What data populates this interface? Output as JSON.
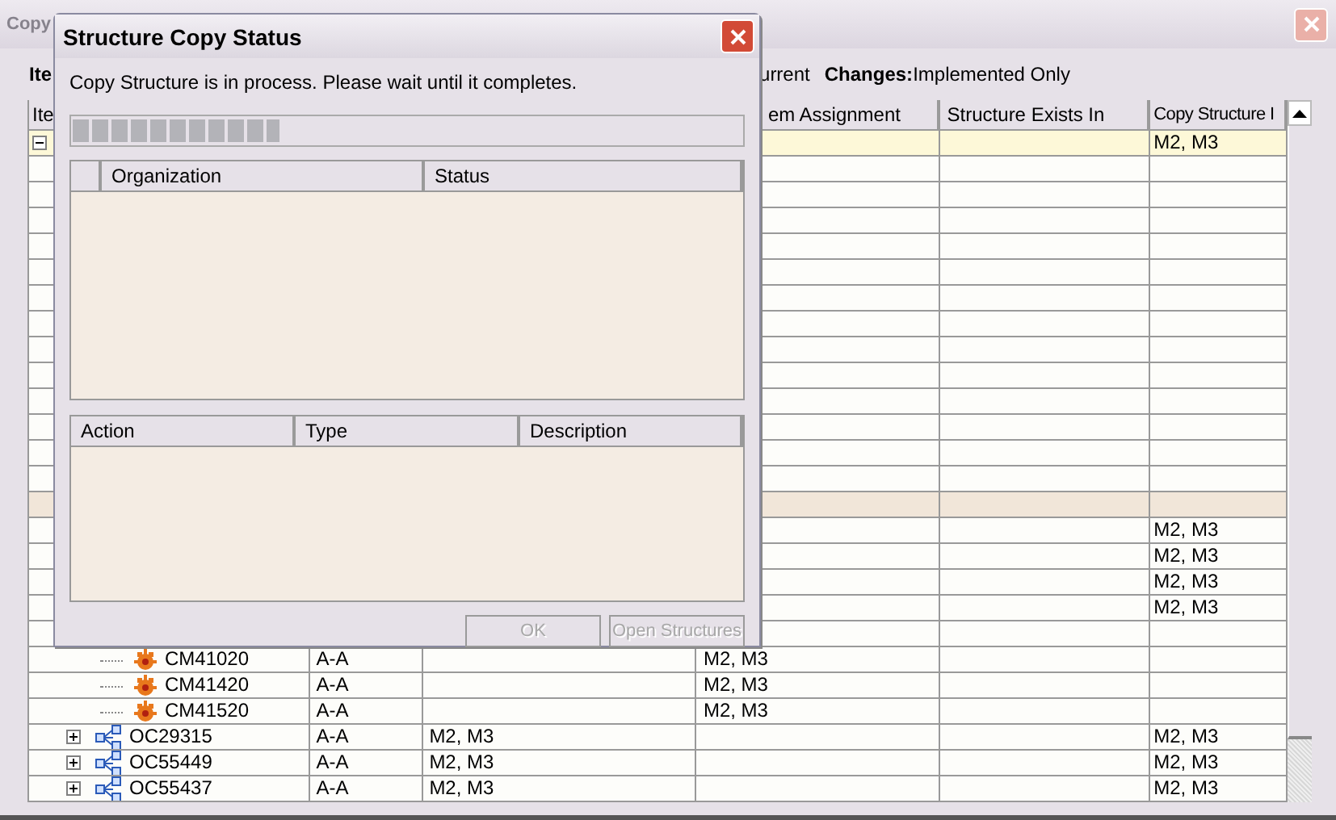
{
  "window": {
    "title": "Copy",
    "close_disabled": true
  },
  "info": {
    "lead": "Ite",
    "filters": [
      "urrent",
      "**Changes:**Implemented Only"
    ]
  },
  "table": {
    "columns": {
      "item": "Ite",
      "assignment": "em Assignment",
      "exists_in": "Structure Exists In",
      "copy_structure": "Copy Structure I"
    },
    "rows": [
      {
        "selected": true,
        "shaded": false,
        "expanded": true,
        "copy_structure": "M2, M3",
        "children": [
          {
            "selected": false,
            "shaded": false
          },
          {
            "selected": false,
            "shaded": false
          },
          {
            "selected": false,
            "shaded": false
          },
          {
            "selected": false,
            "shaded": false
          },
          {
            "selected": false,
            "shaded": false
          },
          {
            "selected": false,
            "shaded": false
          },
          {
            "selected": false,
            "shaded": false
          },
          {
            "selected": false,
            "shaded": false
          },
          {
            "selected": false,
            "shaded": false
          },
          {
            "selected": false,
            "shaded": false
          },
          {
            "selected": false,
            "shaded": false
          },
          {
            "selected": false,
            "shaded": false
          },
          {
            "selected": false,
            "shaded": false
          },
          {
            "selected": false,
            "shaded": true
          },
          {
            "selected": false,
            "shaded": false,
            "copy_structure": "M2, M3"
          },
          {
            "selected": false,
            "shaded": false,
            "copy_structure": "M2, M3"
          },
          {
            "selected": false,
            "shaded": false,
            "copy_structure": "M2, M3"
          },
          {
            "selected": false,
            "shaded": false,
            "copy_structure": "M2, M3"
          },
          {
            "selected": false,
            "shaded": false,
            "children": [
              {
                "selected": false,
                "shaded": false,
                "kind": "part",
                "item": "CM41020",
                "column_2": "A-A",
                "assignment": "M2, M3"
              },
              {
                "selected": false,
                "shaded": false,
                "kind": "part",
                "item": "CM41420",
                "column_2": "A-A",
                "assignment": "M2, M3"
              },
              {
                "selected": false,
                "shaded": false,
                "kind": "part",
                "item": "CM41520",
                "column_2": "A-A",
                "assignment": "M2, M3"
              }
            ]
          },
          {
            "selected": false,
            "shaded": false,
            "kind": "structure",
            "expanded": false,
            "item": "OC29315",
            "column_2": "A-A",
            "column_3": "M2, M3",
            "copy_structure": "M2, M3"
          },
          {
            "selected": false,
            "shaded": false,
            "kind": "structure",
            "expanded": false,
            "item": "OC55449",
            "column_2": "A-A",
            "column_3": "M2, M3",
            "copy_structure": "M2, M3"
          },
          {
            "selected": false,
            "shaded": false,
            "kind": "structure",
            "expanded": false,
            "item": "OC55437",
            "column_2": "A-A",
            "column_3": "M2, M3",
            "copy_structure": "M2, M3"
          }
        ]
      }
    ]
  },
  "dialog": {
    "title": "Structure Copy Status",
    "message": "Copy Structure is in process. Please wait until it completes.",
    "progress": {
      "level": 0.31
    },
    "organizations": {
      "columns": [
        "Organization",
        "Status"
      ]
    },
    "actions": {
      "columns": [
        "Action",
        "Type",
        "Description"
      ]
    },
    "buttons": [
      {
        "label": "OK",
        "disabled": true
      },
      {
        "label": "Open Structures",
        "disabled": true
      }
    ]
  }
}
